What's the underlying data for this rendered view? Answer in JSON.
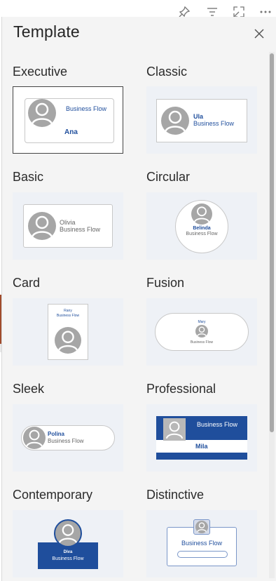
{
  "panel": {
    "title": "Template"
  },
  "toolbar": {
    "pin": "pin-icon",
    "filter": "filter-icon",
    "expand": "expand-icon",
    "more": "more-icon"
  },
  "templates": [
    {
      "label": "Executive",
      "name": "Ana",
      "org": "Business Flow",
      "selected": true
    },
    {
      "label": "Classic",
      "name": "Ula",
      "org": "Business Flow"
    },
    {
      "label": "Basic",
      "name": "Olivia",
      "org": "Business Flow"
    },
    {
      "label": "Circular",
      "name": "Belinda",
      "org": "Business Flow"
    },
    {
      "label": "Card",
      "name": "Rany",
      "org": "Business Flow"
    },
    {
      "label": "Fusion",
      "name": "Mary",
      "org": "Business Flow"
    },
    {
      "label": "Sleek",
      "name": "Polina",
      "org": "Business Flow"
    },
    {
      "label": "Professional",
      "name": "Mila",
      "org": "Business Flow"
    },
    {
      "label": "Contemporary",
      "name": "Diva",
      "org": "Business Flow"
    },
    {
      "label": "Distinctive",
      "name": "",
      "org": "Business Flow"
    }
  ],
  "colors": {
    "accent": "#1f4e9c",
    "avatar": "#a6a6a6"
  }
}
